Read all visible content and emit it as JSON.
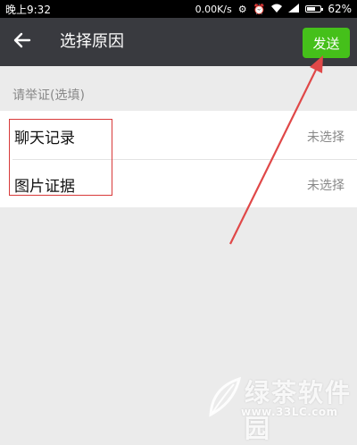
{
  "status_bar": {
    "time": "晚上9:32",
    "network_speed": "0.00K/s",
    "battery": "62%",
    "battery_level": 0.62
  },
  "header": {
    "title": "选择原因",
    "send_label": "发送",
    "back_icon": "arrow-left-icon"
  },
  "section": {
    "label": "请举证(选填)"
  },
  "items": [
    {
      "name": "聊天记录",
      "value": "未选择"
    },
    {
      "name": "图片证据",
      "value": "未选择"
    }
  ],
  "watermark": {
    "text": "绿茶软件园",
    "url": "www.33LC.com"
  },
  "colors": {
    "header_bg": "#393a3f",
    "send_button": "#45c01a",
    "annotation": "#d83a3a"
  }
}
